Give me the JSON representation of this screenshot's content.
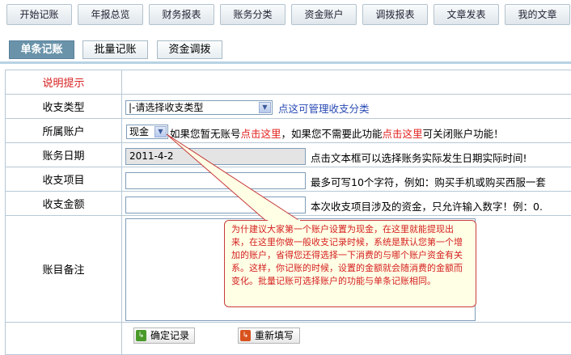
{
  "nav": [
    "开始记账",
    "年报总览",
    "财务报表",
    "账务分类",
    "资金账户",
    "调拨报表",
    "文章发表",
    "我的文章"
  ],
  "subtabs": [
    "单条记账",
    "批量记账",
    "资金调拨"
  ],
  "rows": {
    "notice": {
      "label": "说明提示"
    },
    "type": {
      "label": "收支类型",
      "select_value": "|-请选择收支类型",
      "link": "点这可管理收支分类"
    },
    "account": {
      "label": "所属账户",
      "select_value": "现金",
      "t1": "如果您暂无账号",
      "l1": "点击这里",
      "t2": "，如果您不需要此功能",
      "l2": "点击这里",
      "t3": "可关闭账户功能！"
    },
    "date": {
      "label": "账务日期",
      "value": "2011-4-2",
      "hint": "点击文本框可以选择账务实际发生日期实际时间!"
    },
    "item": {
      "label": "收支项目",
      "hint": "最多可写10个字符，例如：购买手机或购买西服一套"
    },
    "amount": {
      "label": "收支金额",
      "hint": "本次收支项目涉及的资金，只允许输入数字！例：0."
    },
    "remark": {
      "label": "账目备注"
    }
  },
  "tooltip": "为什建议大家第一个账户设置为现金，在这里就能提现出来，在这里你做一般收支记录时候，系统是默认您第一个增加的账户，省得您还得选择一下消费的与哪个账户资金有关系。这样，你记账的时候，设置的金额就会随消费的金额而变化。批量记账可选择账户的功能与单条记账相同。",
  "buttons": {
    "confirm": "确定记录",
    "reset": "重新填写"
  },
  "colors": {
    "accent": "#6a93aa",
    "warning": "#d52020",
    "link": "#2a4bb5"
  }
}
